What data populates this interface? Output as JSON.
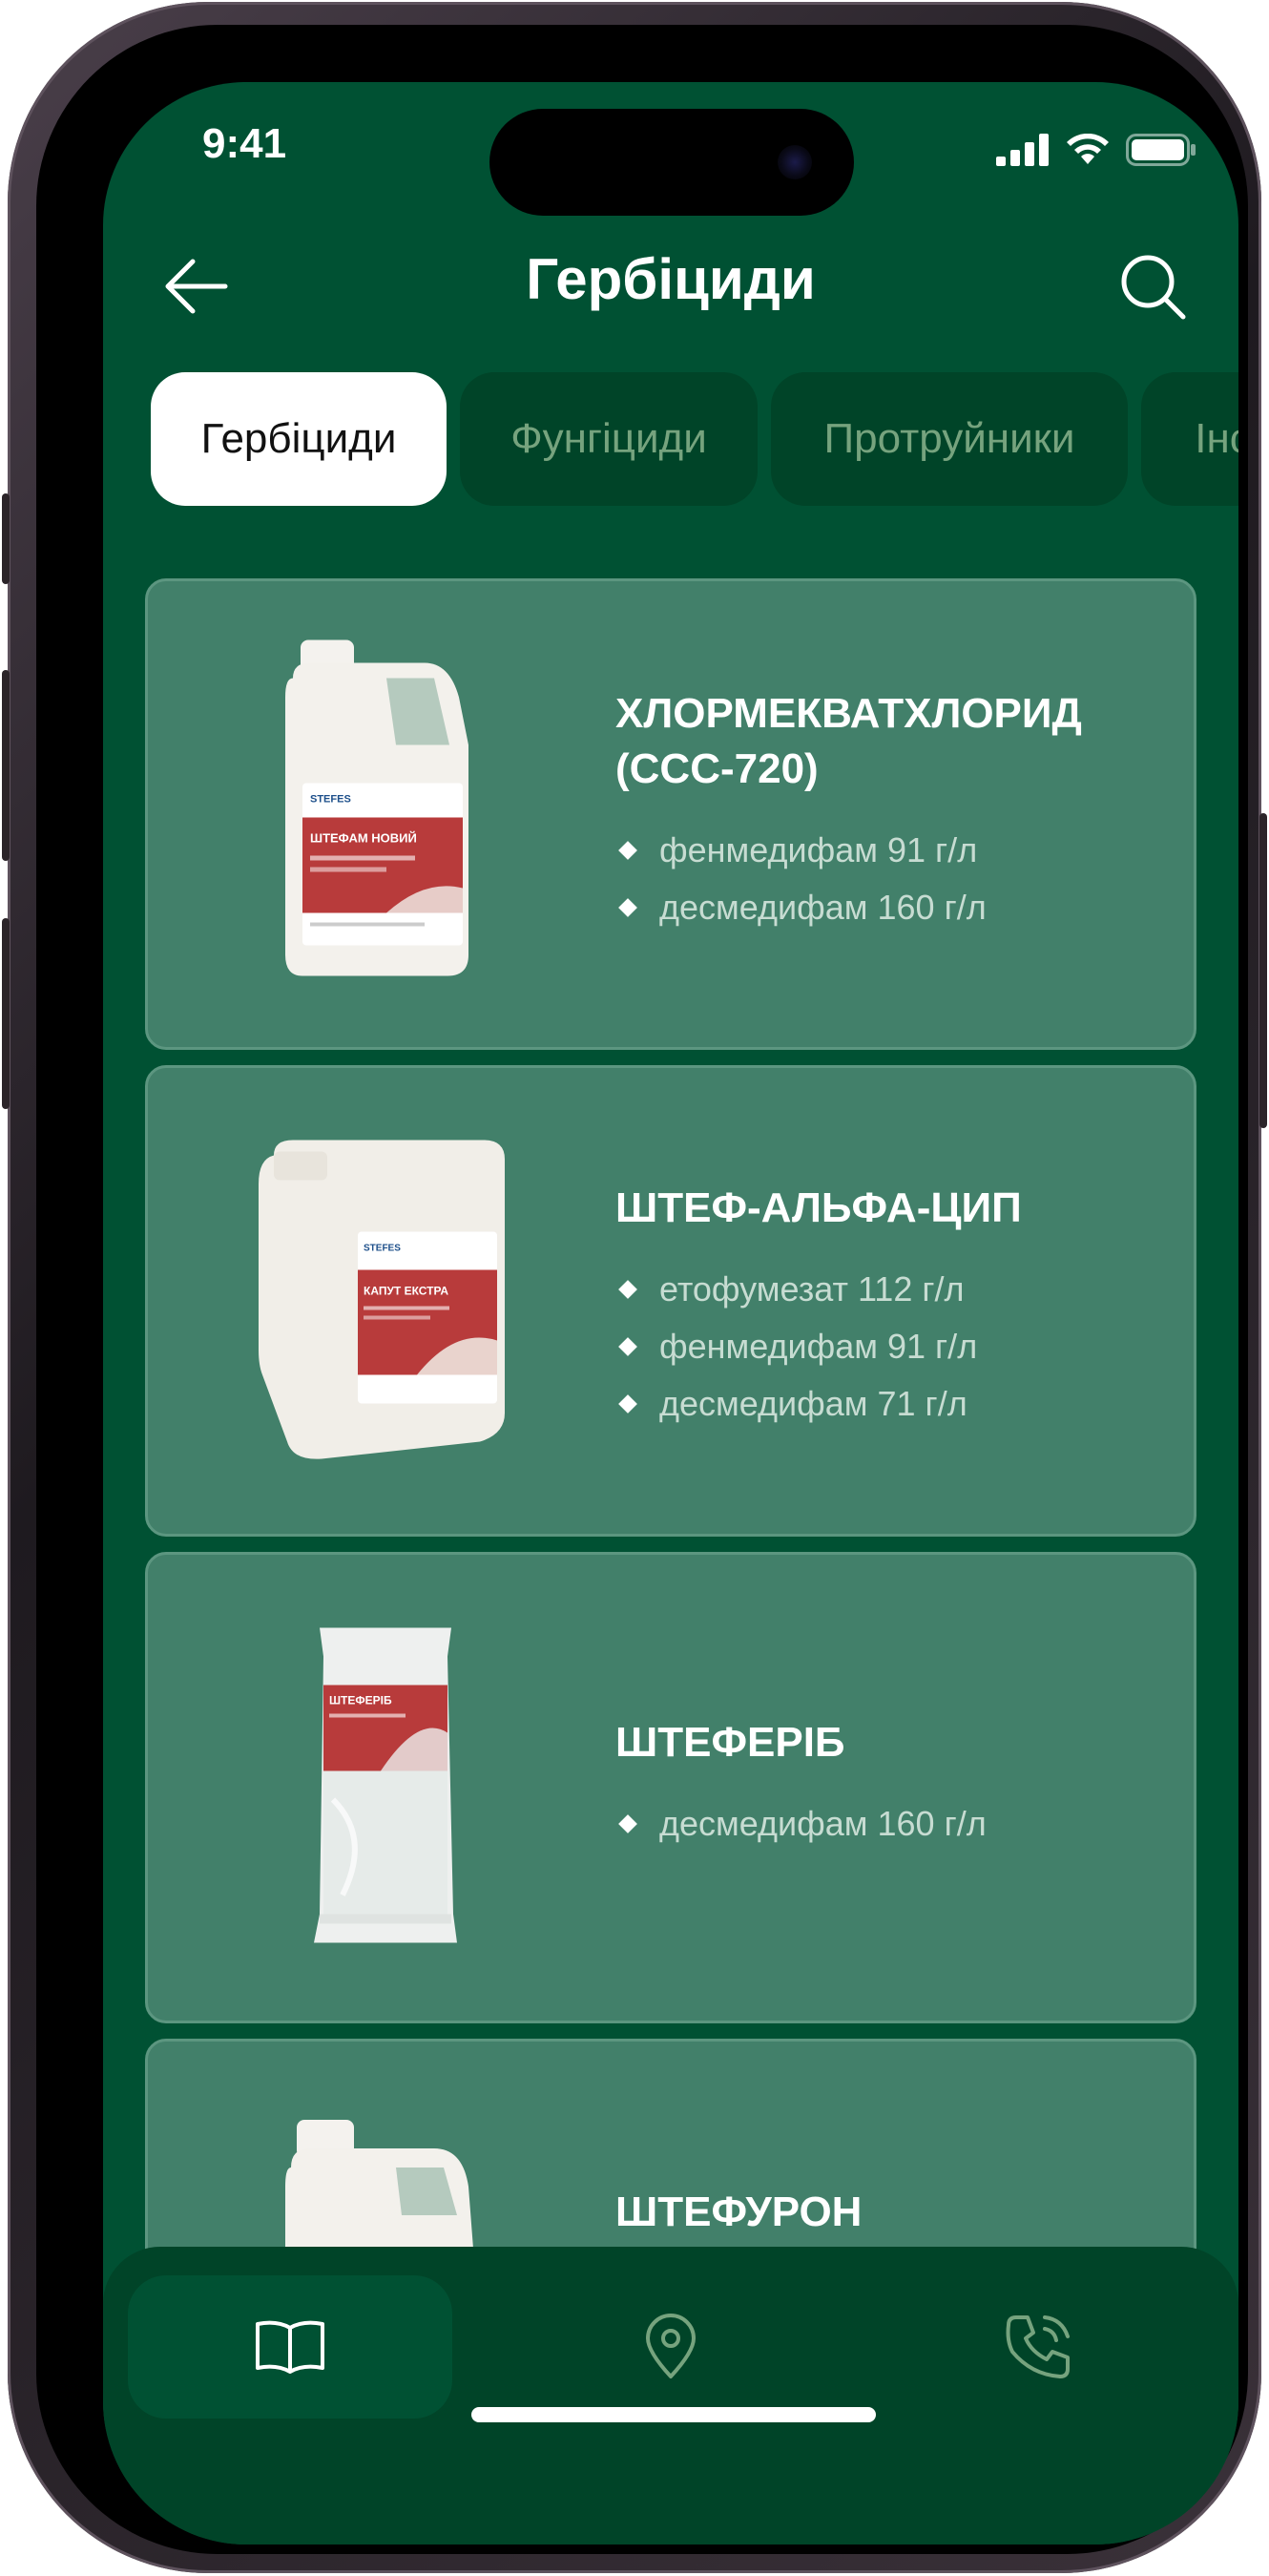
{
  "status_bar": {
    "time": "9:41"
  },
  "header": {
    "title": "Гербіциди"
  },
  "categories": [
    {
      "label": "Гербіциди",
      "active": true
    },
    {
      "label": "Фунгіциди",
      "active": false
    },
    {
      "label": "Протруйники",
      "active": false
    },
    {
      "label": "Інсектициди",
      "active": false
    }
  ],
  "products": [
    {
      "name": "ХЛОРМЕКВАТХЛОРИД (ССС-720)",
      "ingredients": [
        "фенмедифам 91 г/л",
        "десмедифам 160 г/л"
      ],
      "image": "canister-bottle",
      "label_brand": "STEFES",
      "label_name": "ШТЕФАМ НОВИЙ"
    },
    {
      "name": "ШТЕФ-АЛЬФА-ЦИП",
      "ingredients": [
        "етофумезат 112 г/л",
        "фенмедифам 91 г/л",
        "десмедифам 71 г/л"
      ],
      "image": "canister-large",
      "label_brand": "STEFES",
      "label_name": "КАПУТ ЕКСТРА"
    },
    {
      "name": "ШТЕФЕРІБ",
      "ingredients": [
        "десмедифам 160 г/л"
      ],
      "image": "pouch",
      "label_brand": "",
      "label_name": "ШТЕФЕРІБ"
    },
    {
      "name": "ШТЕФУРОН",
      "ingredients": [],
      "image": "canister-bottle",
      "label_brand": "",
      "label_name": ""
    }
  ],
  "bottom_nav": [
    {
      "icon": "book-icon",
      "active": true
    },
    {
      "icon": "location-pin-icon",
      "active": false
    },
    {
      "icon": "phone-call-icon",
      "active": false
    }
  ],
  "colors": {
    "screen_bg": "#005133",
    "card_bg": "#42806a",
    "tab_inactive_bg": "#004428",
    "tab_inactive_text": "#76a37e",
    "label_red": "#b83b3b"
  }
}
